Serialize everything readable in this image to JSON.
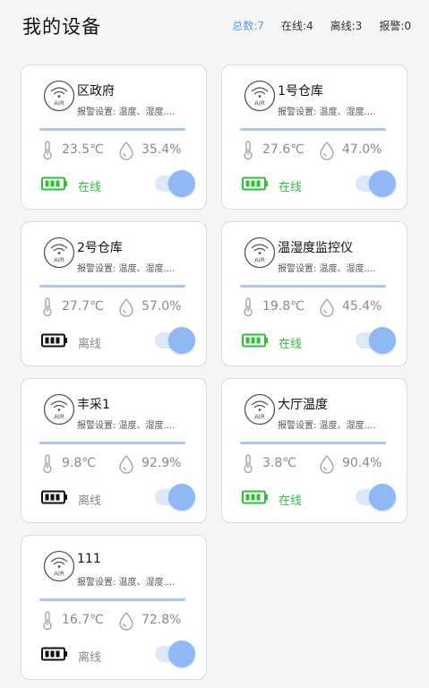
{
  "header": {
    "title": "我的设备",
    "stats": {
      "total": "总数:7",
      "online": "在线:4",
      "offline": "离线:3",
      "alarm": "报警:0"
    }
  },
  "colors": {
    "accent": "#5b9bf0",
    "online": "#2fbf3a",
    "offline_battery": "#111111",
    "toggle_on": "#8eb9f4"
  },
  "devices": [
    {
      "name": "区政府",
      "icon_label": "AIR",
      "alarm": "报警设置: 温度、湿度....",
      "temp": "23.5℃",
      "humidity": "35.4%",
      "status": "在线",
      "online": true,
      "switch_on": true
    },
    {
      "name": "1号仓库",
      "icon_label": "AIR",
      "alarm": "报警设置: 温度、湿度....",
      "temp": "27.6℃",
      "humidity": "47.0%",
      "status": "在线",
      "online": true,
      "switch_on": true
    },
    {
      "name": "2号仓库",
      "icon_label": "AIR",
      "alarm": "报警设置: 温度、湿度....",
      "temp": "27.7℃",
      "humidity": "57.0%",
      "status": "离线",
      "online": false,
      "switch_on": true
    },
    {
      "name": "温湿度监控仪",
      "icon_label": "AIR",
      "alarm": "报警设置: 温度、湿度....",
      "temp": "19.8℃",
      "humidity": "45.4%",
      "status": "在线",
      "online": true,
      "switch_on": true
    },
    {
      "name": "丰采1",
      "icon_label": "AIR",
      "alarm": "报警设置: 温度、湿度....",
      "temp": "9.8℃",
      "humidity": "92.9%",
      "status": "离线",
      "online": false,
      "switch_on": true
    },
    {
      "name": "大厅温度",
      "icon_label": "AIR",
      "alarm": "报警设置: 温度、湿度....",
      "temp": "3.8℃",
      "humidity": "90.4%",
      "status": "在线",
      "online": true,
      "switch_on": true
    },
    {
      "name": "111",
      "icon_label": "AIR",
      "alarm": "报警设置: 温度、湿度....",
      "temp": "16.7℃",
      "humidity": "72.8%",
      "status": "离线",
      "online": false,
      "switch_on": true
    }
  ]
}
